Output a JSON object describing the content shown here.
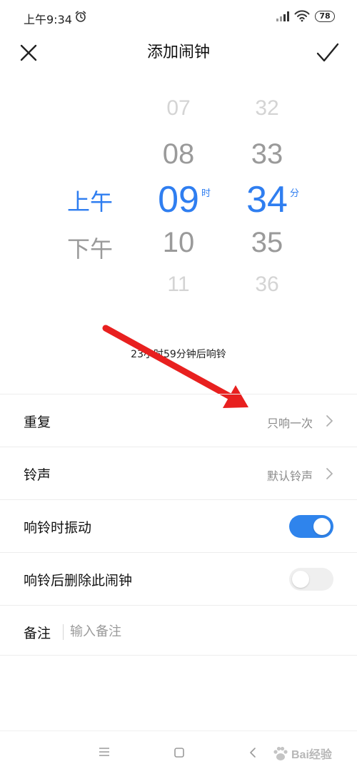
{
  "status_bar": {
    "time": "上午9:34",
    "battery": "78"
  },
  "header": {
    "title": "添加闹钟"
  },
  "picker": {
    "ampm": {
      "selected": "上午",
      "next": "下午"
    },
    "hours": {
      "far_prev": "07",
      "prev": "08",
      "selected": "09",
      "next": "10",
      "far_next": "11",
      "unit": "时"
    },
    "minutes": {
      "far_prev": "32",
      "prev": "33",
      "selected": "34",
      "next": "35",
      "far_next": "36",
      "unit": "分"
    }
  },
  "countdown": "23小时59分钟后响铃",
  "settings": {
    "repeat": {
      "label": "重复",
      "value": "只响一次"
    },
    "ringtone": {
      "label": "铃声",
      "value": "默认铃声"
    },
    "vibrate": {
      "label": "响铃时振动",
      "on": true
    },
    "delete_after": {
      "label": "响铃后删除此闹钟",
      "on": false
    },
    "note": {
      "label": "备注",
      "placeholder": "输入备注",
      "value": ""
    }
  },
  "watermark": {
    "text": "Bai经验"
  },
  "colors": {
    "accent": "#2f7ef0",
    "toggle_on": "#2f84ec",
    "annotation_arrow": "#e8201f"
  },
  "icons": {
    "close": "close-icon",
    "confirm": "check-icon",
    "chevron": "chevron-right-icon",
    "alarm": "alarm-clock-icon",
    "signal": "signal-icon",
    "wifi": "wifi-icon",
    "nav_menu": "menu-icon",
    "nav_home": "home-icon",
    "nav_back": "back-icon"
  }
}
